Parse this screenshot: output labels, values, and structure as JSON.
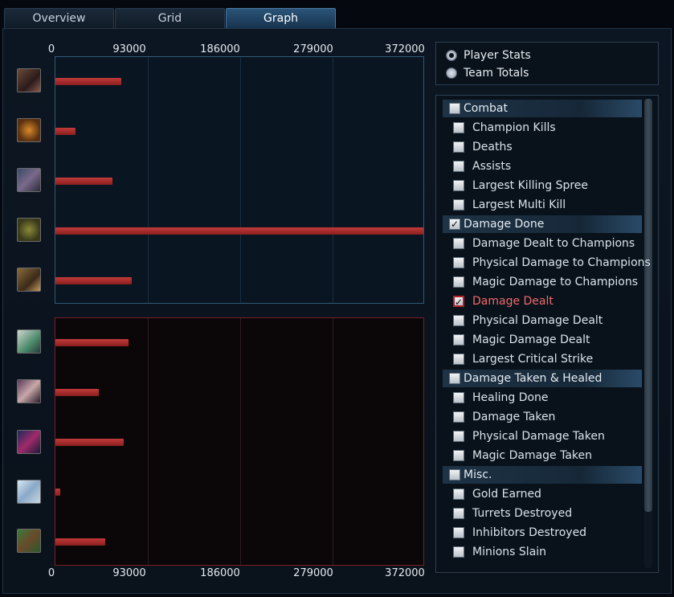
{
  "tabs": [
    {
      "label": "Overview"
    },
    {
      "label": "Grid"
    },
    {
      "label": "Graph",
      "active": true
    }
  ],
  "axis": {
    "ticks": [
      "0",
      "93000",
      "186000",
      "279000",
      "372000"
    ],
    "max": 372000
  },
  "view_options": {
    "selected": "Player Stats",
    "options": [
      {
        "label": "Player Stats",
        "checked": true
      },
      {
        "label": "Team Totals",
        "checked": false
      }
    ]
  },
  "stat_sections": [
    {
      "header": "Combat",
      "checked": false,
      "items": [
        {
          "label": "Champion Kills",
          "checked": false
        },
        {
          "label": "Deaths",
          "checked": false
        },
        {
          "label": "Assists",
          "checked": false
        },
        {
          "label": "Largest Killing Spree",
          "checked": false
        },
        {
          "label": "Largest Multi Kill",
          "checked": false
        }
      ]
    },
    {
      "header": "Damage Done",
      "checked": true,
      "items": [
        {
          "label": "Damage Dealt to Champions",
          "checked": false
        },
        {
          "label": "Physical Damage to Champions",
          "checked": false
        },
        {
          "label": "Magic Damage to Champions",
          "checked": false
        },
        {
          "label": "Damage Dealt",
          "checked": true,
          "selected": true
        },
        {
          "label": "Physical Damage Dealt",
          "checked": false
        },
        {
          "label": "Magic Damage Dealt",
          "checked": false
        },
        {
          "label": "Largest Critical Strike",
          "checked": false
        }
      ]
    },
    {
      "header": "Damage Taken & Healed",
      "checked": false,
      "items": [
        {
          "label": "Healing Done",
          "checked": false
        },
        {
          "label": "Damage Taken",
          "checked": false
        },
        {
          "label": "Physical Damage Taken",
          "checked": false
        },
        {
          "label": "Magic Damage Taken",
          "checked": false
        }
      ]
    },
    {
      "header": "Misc.",
      "checked": false,
      "items": [
        {
          "label": "Gold Earned",
          "checked": false
        },
        {
          "label": "Turrets Destroyed",
          "checked": false
        },
        {
          "label": "Inhibitors Destroyed",
          "checked": false
        },
        {
          "label": "Minions Slain",
          "checked": false
        }
      ]
    }
  ],
  "chart_data": {
    "type": "bar",
    "orientation": "horizontal",
    "xlim": [
      0,
      372000
    ],
    "grid": true,
    "series": [
      {
        "team": "blue",
        "values": [
          67000,
          20000,
          58000,
          372000,
          77000
        ]
      },
      {
        "team": "red",
        "values": [
          74000,
          44000,
          69000,
          5000,
          50000
        ]
      }
    ]
  },
  "colors": {
    "bar": "#b33030",
    "blue_team_border": "#2f5a78",
    "red_team_border": "#7a1e26",
    "highlight_text": "#f06a6a"
  }
}
